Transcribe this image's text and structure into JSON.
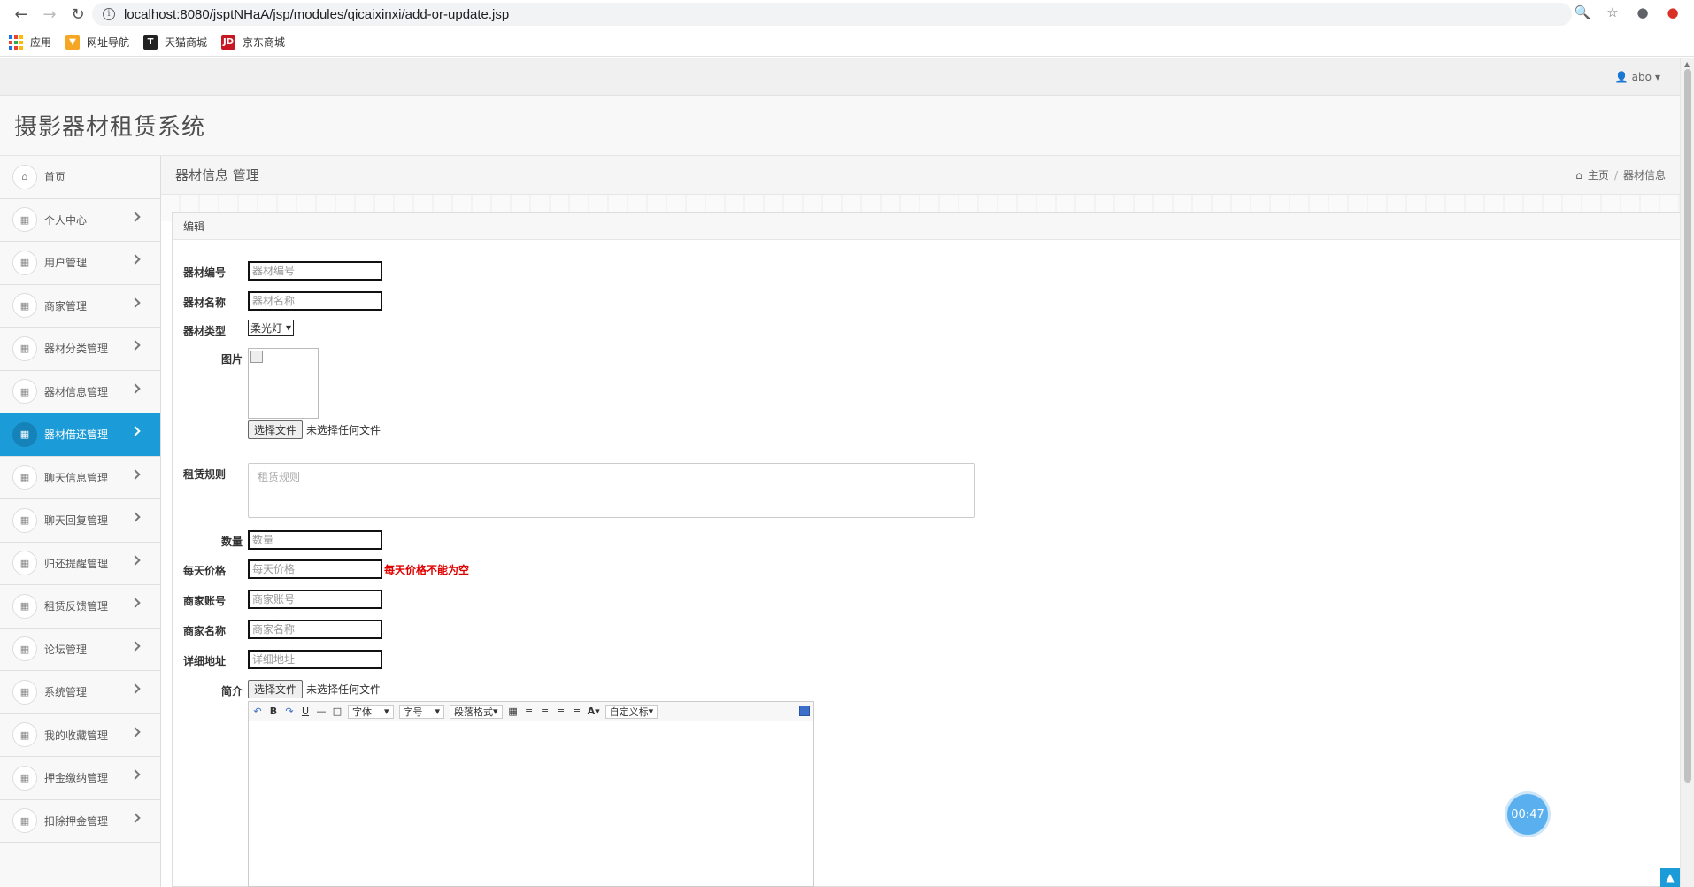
{
  "browser": {
    "url": "localhost:8080/jsptNHaA/jsp/modules/qicaixinxi/add-or-update.jsp",
    "bookmarks": [
      {
        "label": "应用",
        "icon": "apps-grid-icon"
      },
      {
        "label": "网址导航",
        "icon": "nav-bookmark-icon",
        "color": "#f5a623"
      },
      {
        "label": "天猫商城",
        "icon": "tmall-icon",
        "color": "#222"
      },
      {
        "label": "京东商城",
        "icon": "jd-icon",
        "color": "#c81623"
      }
    ]
  },
  "topbar": {
    "user": "abo"
  },
  "brand": {
    "title": "摄影器材租赁系统"
  },
  "sidebar": {
    "items": [
      {
        "label": "首页",
        "icon": "home-icon"
      },
      {
        "label": "个人中心",
        "icon": "table-icon"
      },
      {
        "label": "用户管理",
        "icon": "table-icon"
      },
      {
        "label": "商家管理",
        "icon": "table-icon"
      },
      {
        "label": "器材分类管理",
        "icon": "table-icon"
      },
      {
        "label": "器材信息管理",
        "icon": "table-icon"
      },
      {
        "label": "器材借还管理",
        "icon": "table-icon",
        "active": true
      },
      {
        "label": "聊天信息管理",
        "icon": "table-icon"
      },
      {
        "label": "聊天回复管理",
        "icon": "table-icon"
      },
      {
        "label": "归还提醒管理",
        "icon": "table-icon"
      },
      {
        "label": "租赁反馈管理",
        "icon": "table-icon"
      },
      {
        "label": "论坛管理",
        "icon": "table-icon"
      },
      {
        "label": "系统管理",
        "icon": "table-icon"
      },
      {
        "label": "我的收藏管理",
        "icon": "table-icon"
      },
      {
        "label": "押金缴纳管理",
        "icon": "table-icon"
      },
      {
        "label": "扣除押金管理",
        "icon": "table-icon"
      }
    ]
  },
  "page": {
    "title": "器材信息 管理",
    "breadcrumb": {
      "home": "主页",
      "current": "器材信息"
    },
    "panel_title": "编辑"
  },
  "form": {
    "code": {
      "label": "器材编号",
      "placeholder": "器材编号"
    },
    "name": {
      "label": "器材名称",
      "placeholder": "器材名称"
    },
    "type": {
      "label": "器材类型",
      "value": "柔光灯"
    },
    "image": {
      "label": "图片",
      "file_button": "选择文件",
      "file_status": "未选择任何文件"
    },
    "rules": {
      "label": "租赁规则",
      "placeholder": "租赁规则"
    },
    "quantity": {
      "label": "数量",
      "placeholder": "数量"
    },
    "price": {
      "label": "每天价格",
      "placeholder": "每天价格",
      "error": "每天价格不能为空"
    },
    "merchant_account": {
      "label": "商家账号",
      "placeholder": "商家账号"
    },
    "merchant_name": {
      "label": "商家名称",
      "placeholder": "商家名称"
    },
    "address": {
      "label": "详细地址",
      "placeholder": "详细地址"
    },
    "intro": {
      "label": "简介",
      "file_button": "选择文件",
      "file_status": "未选择任何文件",
      "toolbar": {
        "font": "字体",
        "size": "字号",
        "paragraph": "段落格式",
        "custom": "自定义标"
      }
    }
  },
  "timer": "00:47",
  "colors": {
    "accent": "#1b9bd7",
    "error": "#e00000"
  }
}
